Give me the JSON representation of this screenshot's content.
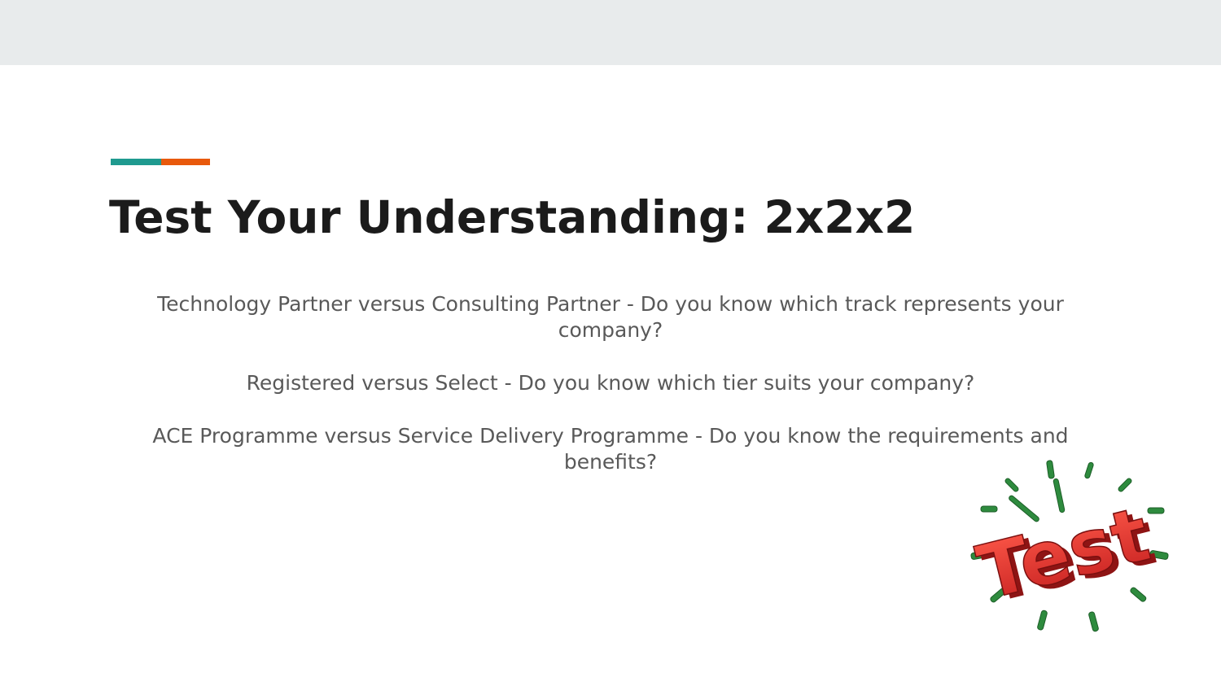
{
  "slide": {
    "title": "Test Your Understanding: 2x2x2",
    "paragraphs": [
      "Technology Partner versus Consulting Partner - Do you know which track represents your company?",
      "Registered versus Select  - Do you know which tier suits your company?",
      "ACE Programme versus Service Delivery Programme - Do you know the requirements and benefits?"
    ],
    "clipart": {
      "icon": "test-clock-icon",
      "word": "Test"
    }
  },
  "colors": {
    "top_band": "#e8ebec",
    "accent_teal": "#1f9a8f",
    "accent_orange": "#e8590c",
    "title": "#1b1b1b",
    "body": "#595959",
    "clip_red": "#e53935",
    "clip_green": "#2e8b3e"
  }
}
